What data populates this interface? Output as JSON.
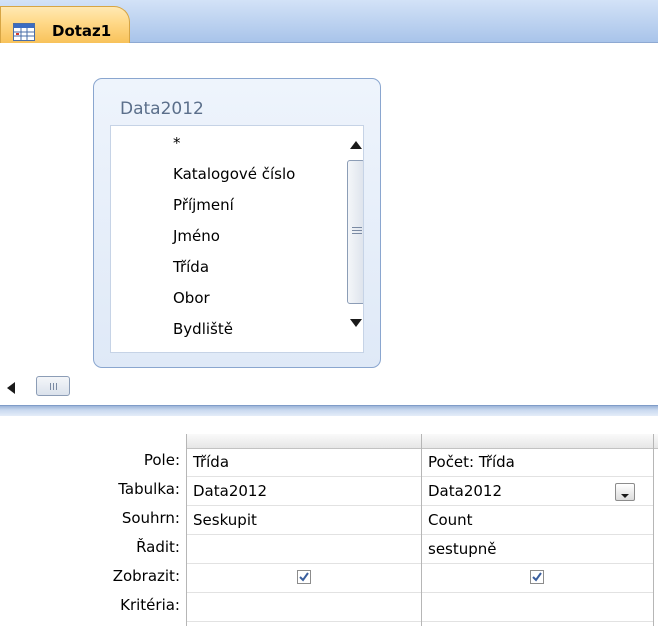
{
  "tab": {
    "title": "Dotaz1",
    "icon": "query-icon"
  },
  "table": {
    "name": "Data2012",
    "fields": [
      "*",
      "Katalogové číslo",
      "Příjmení",
      "Jméno",
      "Třída",
      "Obor",
      "Bydliště"
    ]
  },
  "grid": {
    "row_labels": [
      "Pole:",
      "Tabulka:",
      "Souhrn:",
      "Řadit:",
      "Zobrazit:",
      "Kritéria:"
    ],
    "columns": [
      {
        "field": "Třída",
        "table": "Data2012",
        "total": "Seskupit",
        "sort": "",
        "show": true,
        "criteria": ""
      },
      {
        "field": "Počet: Třída",
        "table": "Data2012",
        "total": "Count",
        "sort": "sestupně",
        "show": true,
        "criteria": ""
      }
    ]
  },
  "colors": {
    "tab_accent": "#ffd887",
    "frame_blue": "#8aa6cf",
    "checkmark": "#3a5f9e"
  }
}
